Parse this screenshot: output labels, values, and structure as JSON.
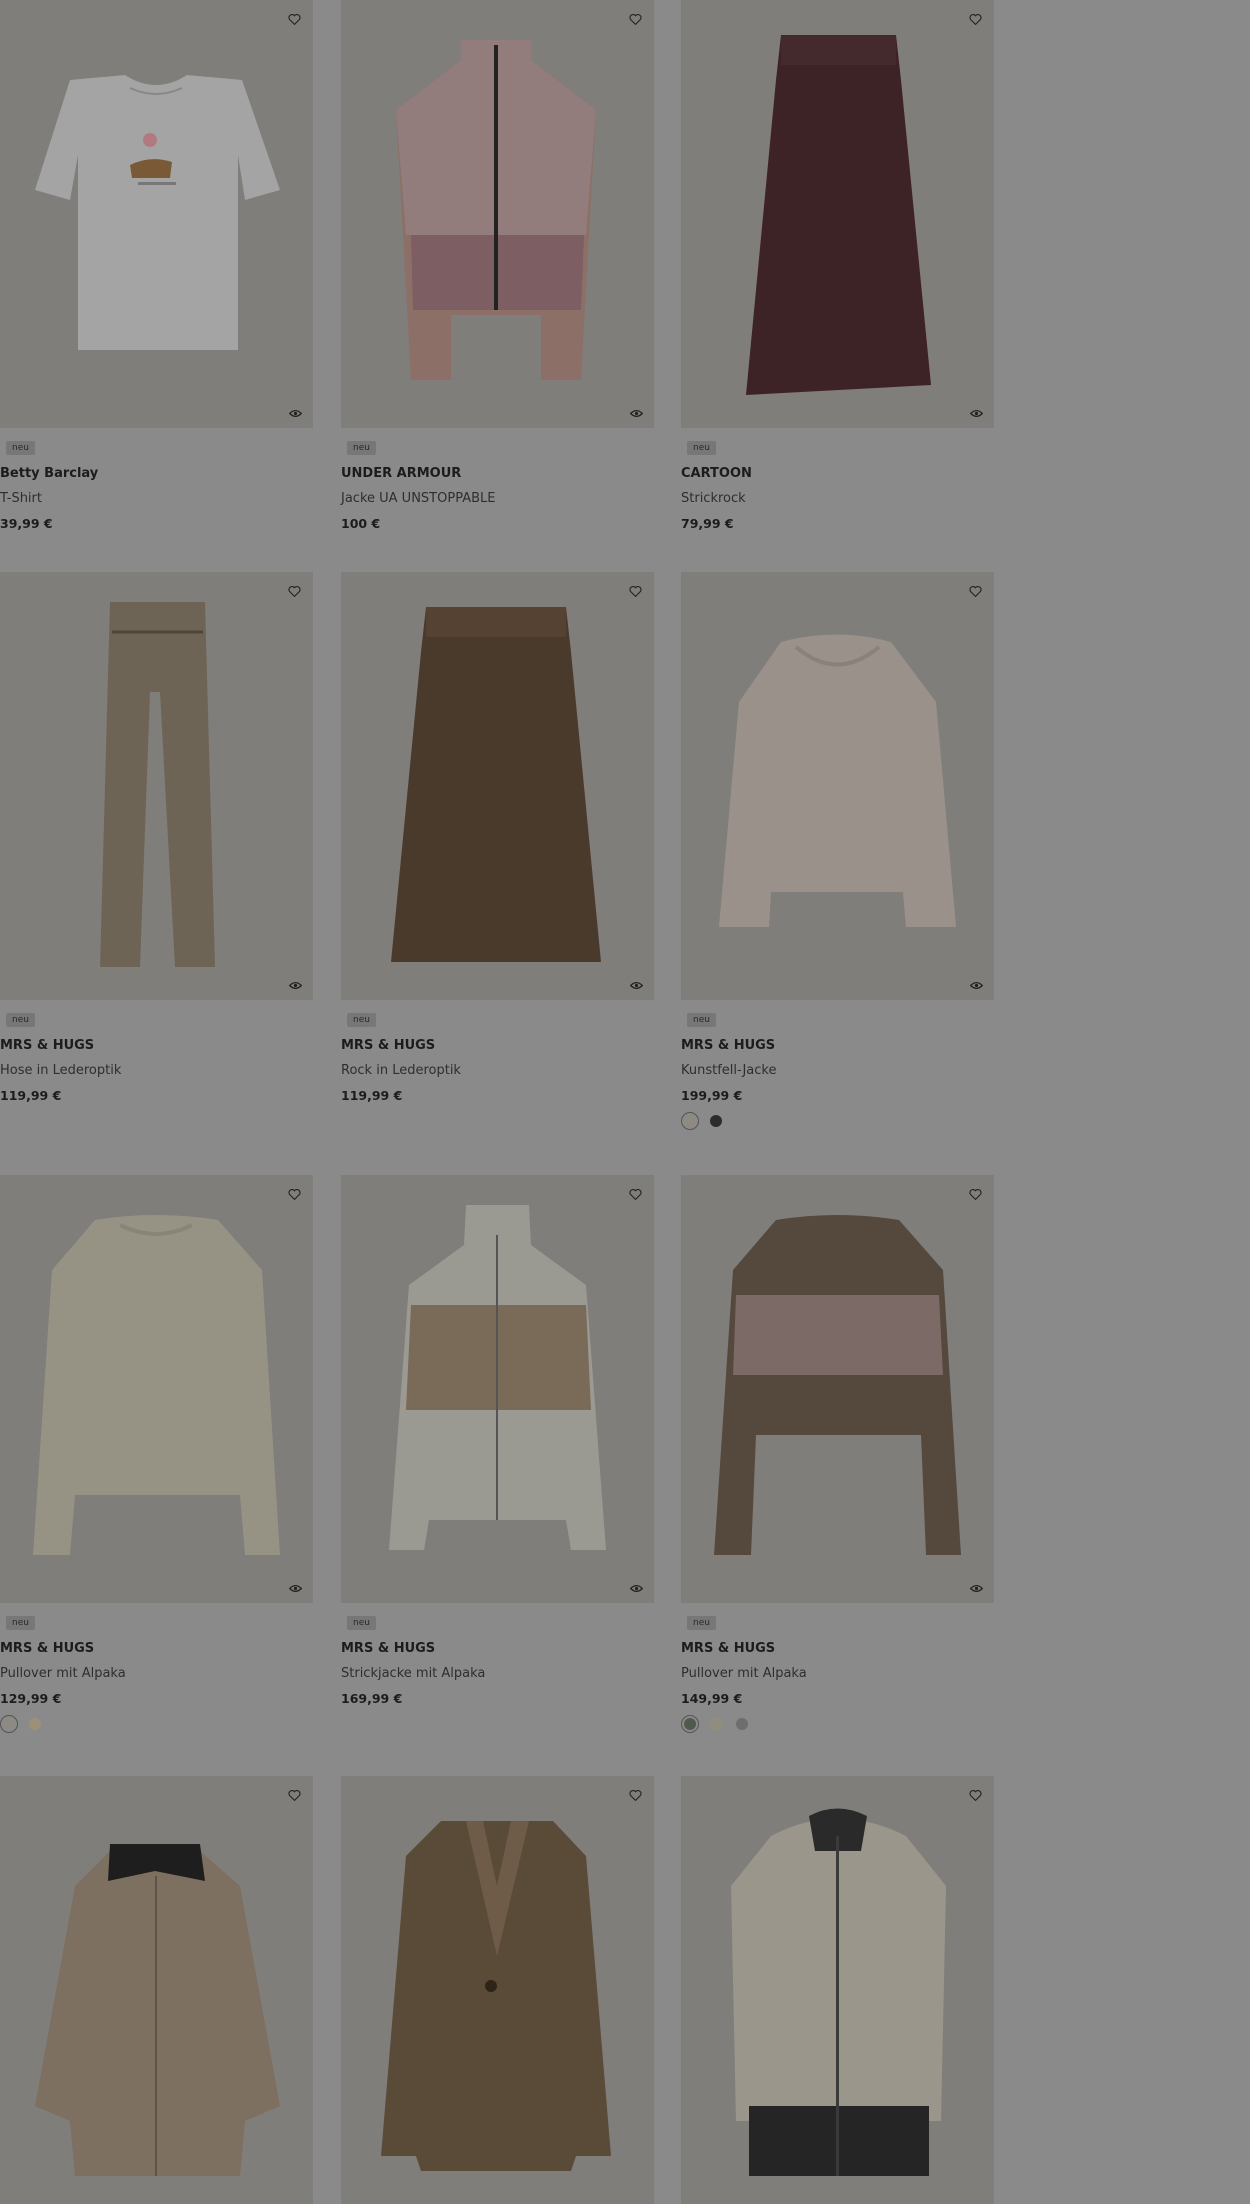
{
  "icons": {
    "wishlist": "heart-icon",
    "quickview": "quickview-icon"
  },
  "products": [
    {
      "badge": "neu",
      "brand": "Betty Barclay",
      "name": "T-Shirt",
      "price": "39,99 €",
      "swatches": []
    },
    {
      "badge": "neu",
      "brand": "UNDER ARMOUR",
      "name": "Jacke UA UNSTOPPABLE",
      "price": "100 €",
      "swatches": []
    },
    {
      "badge": "neu",
      "brand": "CARTOON",
      "name": "Strickrock",
      "price": "79,99 €",
      "swatches": []
    },
    {
      "badge": "neu",
      "brand": "MRS & HUGS",
      "name": "Hose in Lederoptik",
      "price": "119,99 €",
      "swatches": []
    },
    {
      "badge": "neu",
      "brand": "MRS & HUGS",
      "name": "Rock in Lederoptik",
      "price": "119,99 €",
      "swatches": []
    },
    {
      "badge": "neu",
      "brand": "MRS & HUGS",
      "name": "Kunstfell-Jacke",
      "price": "199,99 €",
      "swatches": [
        "#8f8a80",
        "#2c2c2c"
      ]
    },
    {
      "badge": "neu",
      "brand": "MRS & HUGS",
      "name": "Pullover mit Alpaka",
      "price": "129,99 €",
      "swatches": [
        "#8c8a82",
        "#9c9078"
      ]
    },
    {
      "badge": "neu",
      "brand": "MRS & HUGS",
      "name": "Strickjacke mit Alpaka",
      "price": "169,99 €",
      "swatches": []
    },
    {
      "badge": "neu",
      "brand": "MRS & HUGS",
      "name": "Pullover mit Alpaka",
      "price": "149,99 €",
      "swatches": [
        "#4e5a4c",
        "#8f8e7c",
        "#6e6e6e"
      ]
    },
    {
      "badge": "",
      "brand": "",
      "name": "",
      "price": "",
      "swatches": []
    },
    {
      "badge": "",
      "brand": "",
      "name": "",
      "price": "",
      "swatches": []
    },
    {
      "badge": "",
      "brand": "",
      "name": "",
      "price": "",
      "swatches": []
    }
  ]
}
